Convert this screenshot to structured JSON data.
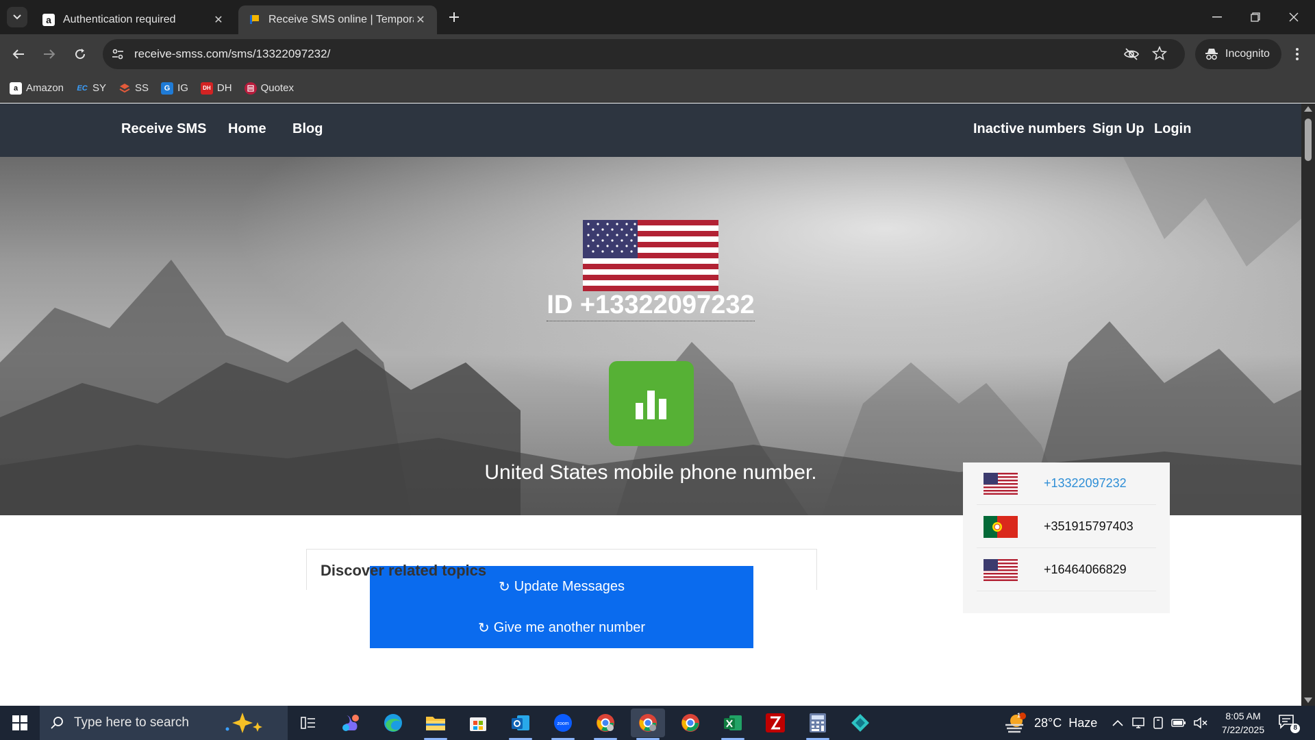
{
  "browser": {
    "tabs": [
      {
        "title": "Authentication required",
        "active": false
      },
      {
        "title": "Receive SMS online | Temporary",
        "active": true
      }
    ],
    "url": "receive-smss.com/sms/13322097232/",
    "profile_label": "Incognito",
    "bookmarks": [
      {
        "label": "Amazon",
        "icon": "amazon-icon"
      },
      {
        "label": "SY",
        "icon": "ec-icon"
      },
      {
        "label": "SS",
        "icon": "ss-icon"
      },
      {
        "label": "IG",
        "icon": "ig-icon"
      },
      {
        "label": "DH",
        "icon": "dh-icon"
      },
      {
        "label": "Quotex",
        "icon": "quotex-icon"
      }
    ]
  },
  "site": {
    "nav_left": [
      "Receive SMS",
      "Home",
      "Blog"
    ],
    "nav_right": [
      "Inactive numbers",
      "Sign Up",
      "Login"
    ],
    "hero": {
      "phone_id": "ID +13322097232",
      "subtitle": "United States mobile phone number."
    },
    "buttons": {
      "update": "Update Messages",
      "another": "Give me another number",
      "refresh_glyph": "↻"
    },
    "related_heading": "Discover related topics",
    "sidebar_numbers": [
      {
        "number": "+13322097232",
        "country": "us",
        "current": true
      },
      {
        "number": "+351915797403",
        "country": "pt",
        "current": false
      },
      {
        "number": "+16464066829",
        "country": "us",
        "current": false
      }
    ]
  },
  "taskbar": {
    "search_placeholder": "Type here to search",
    "weather": "28°C  Haze",
    "weather_badge": "1",
    "time": "8:05 AM",
    "date": "7/22/2025",
    "notification_count": "8"
  },
  "colors": {
    "navbar": "#2d3540",
    "button_blue": "#0a6bee",
    "stats_green": "#56b135",
    "sidebar_link": "#2e8ed6"
  }
}
